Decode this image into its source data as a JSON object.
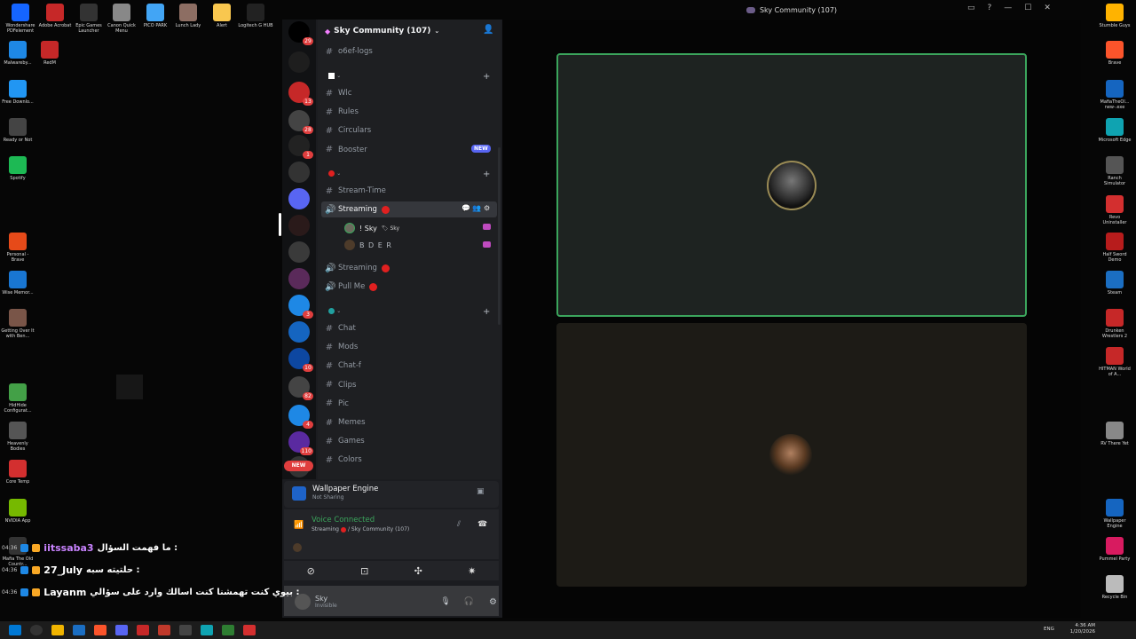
{
  "desktop": {
    "icons_left": [
      {
        "label": "Wondershare PDFelement",
        "color": "#1565ff",
        "x": "l"
      },
      {
        "label": "Adobe Acrobat",
        "color": "#c62828"
      },
      {
        "label": "Epic Games Launcher",
        "color": "#333"
      },
      {
        "label": "Canon Quick Menu",
        "color": "#888"
      },
      {
        "label": "PICO PARK",
        "color": "#42a5f5"
      },
      {
        "label": "Lunch Lady",
        "color": "#8d6e63"
      },
      {
        "label": "Alert",
        "color": "#f9c74f"
      },
      {
        "label": "Logitech G HUB",
        "color": "#222"
      }
    ],
    "icons_left_col": [
      {
        "label": "Malwareby...",
        "color": "#1e88e5"
      },
      {
        "label": "RedM",
        "color": "#c62828"
      },
      {
        "label": "Free Downlo...",
        "color": "#2196f3"
      },
      {
        "label": "Ready or Not",
        "color": "#444"
      },
      {
        "label": "Spotify",
        "color": "#1db954"
      },
      {
        "label": "Personal - Brave",
        "color": "#e64a19"
      },
      {
        "label": "Wise Memor...",
        "color": "#1976d2"
      },
      {
        "label": "Getting Over It with Ben...",
        "color": "#795548"
      },
      {
        "label": "HidHide Configurat...",
        "color": "#43a047"
      },
      {
        "label": "Heavenly Bodies",
        "color": "#555"
      },
      {
        "label": "Core Temp",
        "color": "#d32f2f"
      },
      {
        "label": "NVIDIA App",
        "color": "#76b900"
      },
      {
        "label": "Mafia The Old Countr...",
        "color": "#333"
      }
    ],
    "icons_right": [
      {
        "label": "Stumble Guys",
        "color": "#ffb300"
      },
      {
        "label": "Brave",
        "color": "#fb542b"
      },
      {
        "label": "MafiaTheOl... new-.exe",
        "color": "#1565c0"
      },
      {
        "label": "Microsoft Edge",
        "color": "#0fa3b1"
      },
      {
        "label": "Ranch Simulator",
        "color": "#555"
      },
      {
        "label": "Revo Uninstaller",
        "color": "#d32f2f"
      },
      {
        "label": "Half Sword Demo",
        "color": "#b71c1c"
      },
      {
        "label": "Steam",
        "color": "#1b6ec2"
      },
      {
        "label": "Drunken Wrestlers 2",
        "color": "#c62828"
      },
      {
        "label": "HITMAN World of A...",
        "color": "#c62828"
      },
      {
        "label": "RV There Yet",
        "color": "#888"
      },
      {
        "label": "Wallpaper Engine",
        "color": "#1565c0"
      },
      {
        "label": "Pummel Party",
        "color": "#d81b60"
      },
      {
        "label": "Recycle Bin",
        "color": "#bbb"
      }
    ]
  },
  "window": {
    "title": "Sky Community (107)"
  },
  "server": {
    "name": "Sky Community (107)",
    "top_channel": "o6ef-logs",
    "categories": [
      {
        "channels": [
          "Wlc",
          "Rules",
          "Circulars",
          "Booster"
        ]
      },
      {
        "channels": [
          "Stream-Time"
        ]
      },
      {
        "channels": [
          "Chat",
          "Mods",
          "Chat-f",
          "Clips",
          "Pic",
          "Memes",
          "Games",
          "Colors"
        ]
      }
    ],
    "booster_badge": "NEW",
    "voice_channels": [
      {
        "name": "Streaming"
      },
      {
        "name": "Streaming"
      },
      {
        "name": "Pull Me"
      }
    ],
    "voice_users": [
      {
        "name": "! Sky",
        "tag": "Sky"
      },
      {
        "name": "B D E R"
      }
    ]
  },
  "server_badges": [
    "29",
    "13",
    "28",
    "1",
    "3",
    "10",
    "82",
    "4",
    "110",
    "NEW"
  ],
  "wallpaper": {
    "title": "Wallpaper Engine",
    "status": "Not Sharing"
  },
  "voice": {
    "status": "Voice Connected",
    "channel": "Streaming",
    "server": "/ Sky Community (107)"
  },
  "account": {
    "name": "Sky",
    "status": "Invisible"
  },
  "chat_overlay": [
    {
      "time": "04:36",
      "name": "iitssaba3",
      "msg": "ما فهمت السؤال :"
    },
    {
      "time": "04:36",
      "name": "27_July",
      "msg": "حلتيته سبه :"
    },
    {
      "time": "04:36",
      "name": "Layanm",
      "msg": "بيوي كنت تهمشنا كنت اسالك وارد على سؤالي :"
    }
  ],
  "clock": {
    "time": "4:36 AM",
    "date": "1/20/2026",
    "lang": "ENG"
  },
  "colors": {
    "green": "#3ba55c",
    "red": "#e02020",
    "blurple": "#5865f2"
  }
}
